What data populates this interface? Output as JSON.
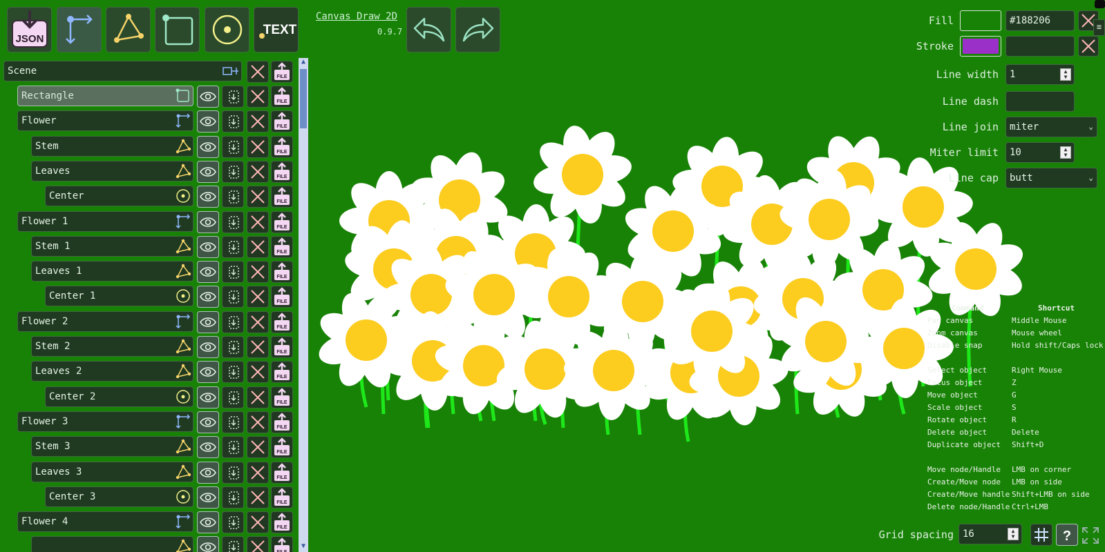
{
  "app": {
    "name": "Canvas Draw 2D",
    "version": "0.9.7"
  },
  "toolbar": {
    "json_label": "JSON",
    "text_label": "TEXT"
  },
  "scene": {
    "label": "Scene",
    "items": [
      {
        "name": "Rectangle",
        "type": "rect",
        "level": 1,
        "selected": true
      },
      {
        "name": "Flower",
        "type": "group",
        "level": 1
      },
      {
        "name": "Stem",
        "type": "path",
        "level": 2
      },
      {
        "name": "Leaves",
        "type": "path",
        "level": 2
      },
      {
        "name": "Center",
        "type": "circle",
        "level": 3
      },
      {
        "name": "Flower 1",
        "type": "group",
        "level": 1
      },
      {
        "name": "Stem 1",
        "type": "path",
        "level": 2
      },
      {
        "name": "Leaves 1",
        "type": "path",
        "level": 2
      },
      {
        "name": "Center 1",
        "type": "circle",
        "level": 3
      },
      {
        "name": "Flower 2",
        "type": "group",
        "level": 1
      },
      {
        "name": "Stem 2",
        "type": "path",
        "level": 2
      },
      {
        "name": "Leaves 2",
        "type": "path",
        "level": 2
      },
      {
        "name": "Center 2",
        "type": "circle",
        "level": 3
      },
      {
        "name": "Flower 3",
        "type": "group",
        "level": 1
      },
      {
        "name": "Stem 3",
        "type": "path",
        "level": 2
      },
      {
        "name": "Leaves 3",
        "type": "path",
        "level": 2
      },
      {
        "name": "Center 3",
        "type": "circle",
        "level": 3
      },
      {
        "name": "Flower 4",
        "type": "group",
        "level": 1
      },
      {
        "name": "",
        "type": "path",
        "level": 2
      }
    ],
    "file_label": "FILE"
  },
  "props": {
    "fill_label": "Fill",
    "fill_color": "#188206",
    "fill_value": "#188206",
    "stroke_label": "Stroke",
    "stroke_color": "#9b30c8",
    "stroke_value": "",
    "line_width_label": "Line width",
    "line_width_value": "1",
    "line_dash_label": "Line dash",
    "line_dash_value": "",
    "line_join_label": "Line join",
    "line_join_value": "miter",
    "miter_limit_label": "Miter limit",
    "miter_limit_value": "10",
    "line_cap_label": "Line cap",
    "line_cap_value": "butt"
  },
  "help": {
    "command_header": "Command",
    "shortcut_header": "Shortcut",
    "rows": [
      [
        "Pan canvas",
        "Middle Mouse"
      ],
      [
        "Zoom canvas",
        "Mouse wheel"
      ],
      [
        "Disable snap",
        "Hold shift/Caps lock"
      ],
      [
        "",
        ""
      ],
      [
        "Select object",
        "Right Mouse"
      ],
      [
        "Focus object",
        "Z"
      ],
      [
        "Move object",
        "G"
      ],
      [
        "Scale object",
        "S"
      ],
      [
        "Rotate object",
        "R"
      ],
      [
        "Delete object",
        "Delete"
      ],
      [
        "Duplicate object",
        "Shift+D"
      ],
      [
        "",
        ""
      ],
      [
        "Move node/Handle",
        "LMB on corner"
      ],
      [
        "Create/Move node",
        "LMB on side"
      ],
      [
        "Create/Move handle",
        "Shift+LMB on side"
      ],
      [
        "Delete node/Handle",
        "Ctrl+LMB"
      ]
    ]
  },
  "grid": {
    "label": "Grid spacing",
    "value": "16"
  },
  "colors": {
    "canvas_bg": "#188206",
    "petal": "#ffffff",
    "center": "#fccc1f",
    "stem": "#1ee81a"
  }
}
